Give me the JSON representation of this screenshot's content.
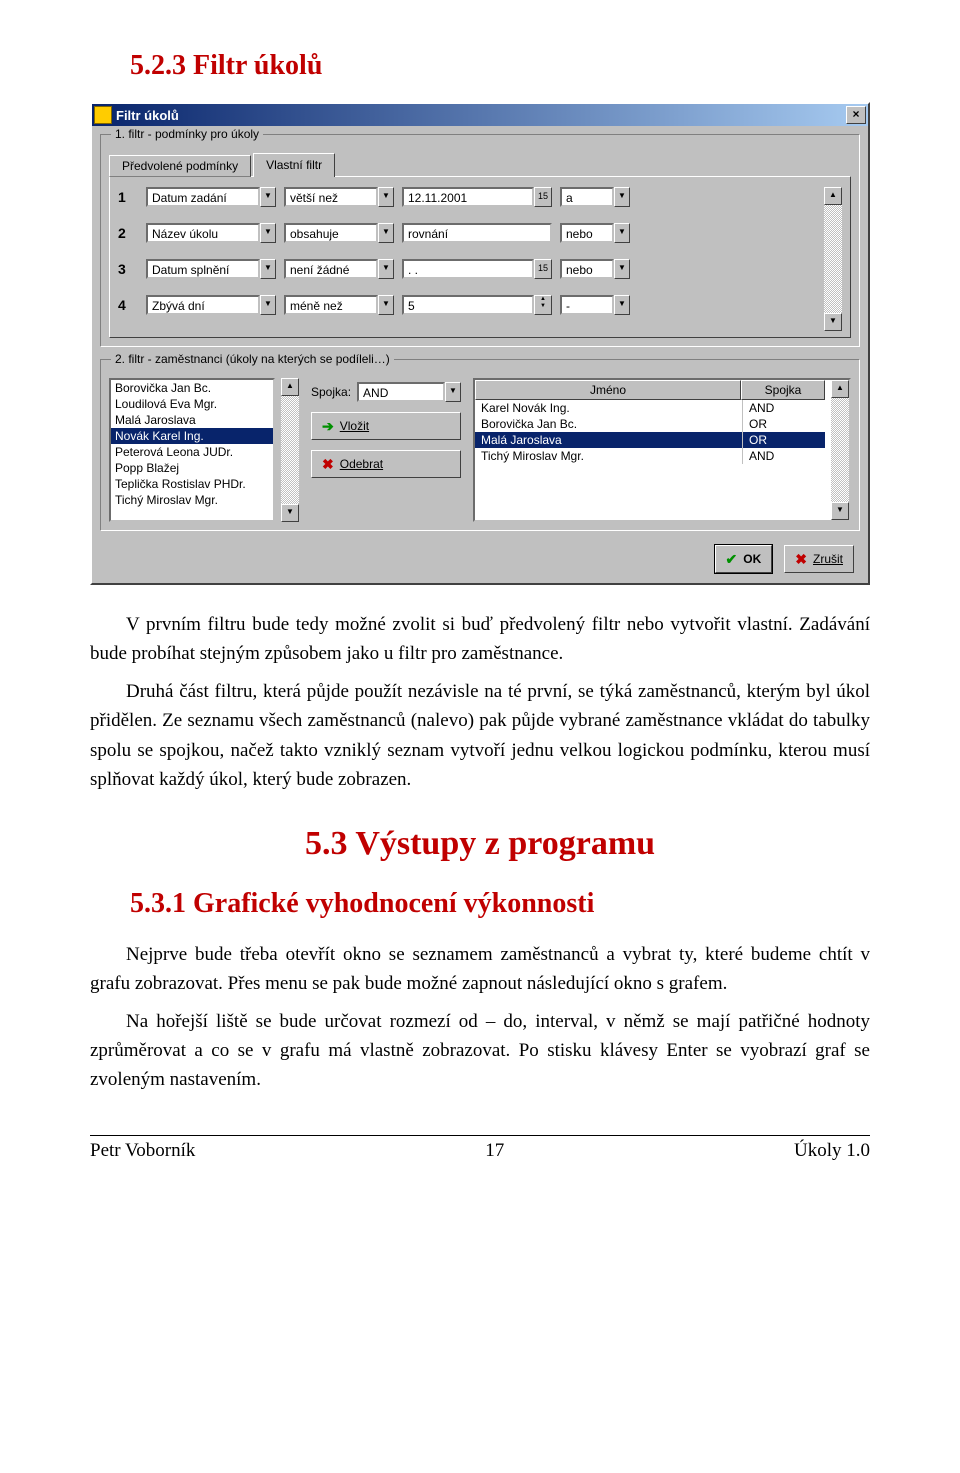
{
  "headings": {
    "h523": "5.2.3  Filtr úkolů",
    "h53": "5.3  Výstupy z programu",
    "h531": "5.3.1  Grafické vyhodnocení výkonnosti"
  },
  "paragraphs": {
    "p1": "V prvním filtru bude tedy možné zvolit si buď předvolený filtr nebo vytvořit vlastní. Zadávání bude probíhat stejným způsobem jako u filtr pro zaměstnance.",
    "p2": "Druhá část filtru, která půjde použít nezávisle na té první, se týká zaměstnanců, kterým byl úkol přidělen. Ze seznamu všech zaměstnanců (nalevo) pak půjde vybrané zaměstnance vkládat do tabulky spolu se spojkou, načež takto vzniklý seznam vytvoří jednu velkou logickou podmínku, kterou musí splňovat každý úkol, který bude zobrazen.",
    "p3": "Nejprve bude třeba otevřít okno se seznamem zaměstnanců a vybrat ty, které budeme chtít v grafu zobrazovat. Přes menu se pak bude možné zapnout následující okno s grafem.",
    "p4": "Na hořejší liště se bude určovat rozmezí od – do, interval, v němž se mají patřičné hodnoty zprůměrovat a co se v grafu má vlastně zobrazovat. Po stisku klávesy Enter se vyobrazí graf se zvoleným nastavením."
  },
  "dialog": {
    "title": "Filtr úkolů",
    "group1": {
      "legend": "1. filtr - podmínky pro úkoly",
      "tabs": {
        "preset": "Předvolené podmínky",
        "custom": "Vlastní filtr"
      },
      "rows": [
        {
          "n": "1",
          "field": "Datum zadání",
          "op": "větší než",
          "val": "12.11.2001",
          "valtype": "date",
          "conj": "a"
        },
        {
          "n": "2",
          "field": "Název úkolu",
          "op": "obsahuje",
          "val": "rovnání",
          "valtype": "text",
          "conj": "nebo"
        },
        {
          "n": "3",
          "field": "Datum splnění",
          "op": "není žádné",
          "val": ".  .",
          "valtype": "date",
          "conj": "nebo"
        },
        {
          "n": "4",
          "field": "Zbývá dní",
          "op": "méně než",
          "val": "5",
          "valtype": "spin",
          "conj": "-"
        }
      ]
    },
    "group2": {
      "legend": "2. filtr - zaměstnanci (úkoly na kterých se podíleli…)",
      "employees": [
        "Borovička Jan Bc.",
        "Loudilová Eva Mgr.",
        "Malá Jaroslava",
        "Novák Karel Ing.",
        "Peterová Leona JUDr.",
        "Popp Blažej",
        "Teplička Rostislav PHDr.",
        "Tichý Miroslav Mgr."
      ],
      "selectedIndex": 3,
      "spojka_label": "Spojka:",
      "spojka_value": "AND",
      "btn_insert": "Vložit",
      "btn_remove": "Odebrat",
      "table": {
        "col_name": "Jméno",
        "col_conj": "Spojka",
        "rows": [
          {
            "name": "Karel Novák Ing.",
            "conj": "AND",
            "sel": false
          },
          {
            "name": "Borovička Jan Bc.",
            "conj": "OR",
            "sel": false
          },
          {
            "name": "Malá Jaroslava",
            "conj": "OR",
            "sel": true
          },
          {
            "name": "Tichý Miroslav Mgr.",
            "conj": "AND",
            "sel": false
          }
        ]
      }
    },
    "btn_ok": "OK",
    "btn_cancel": "Zrušit"
  },
  "footer": {
    "left": "Petr Voborník",
    "center": "17",
    "right": "Úkoly 1.0"
  }
}
